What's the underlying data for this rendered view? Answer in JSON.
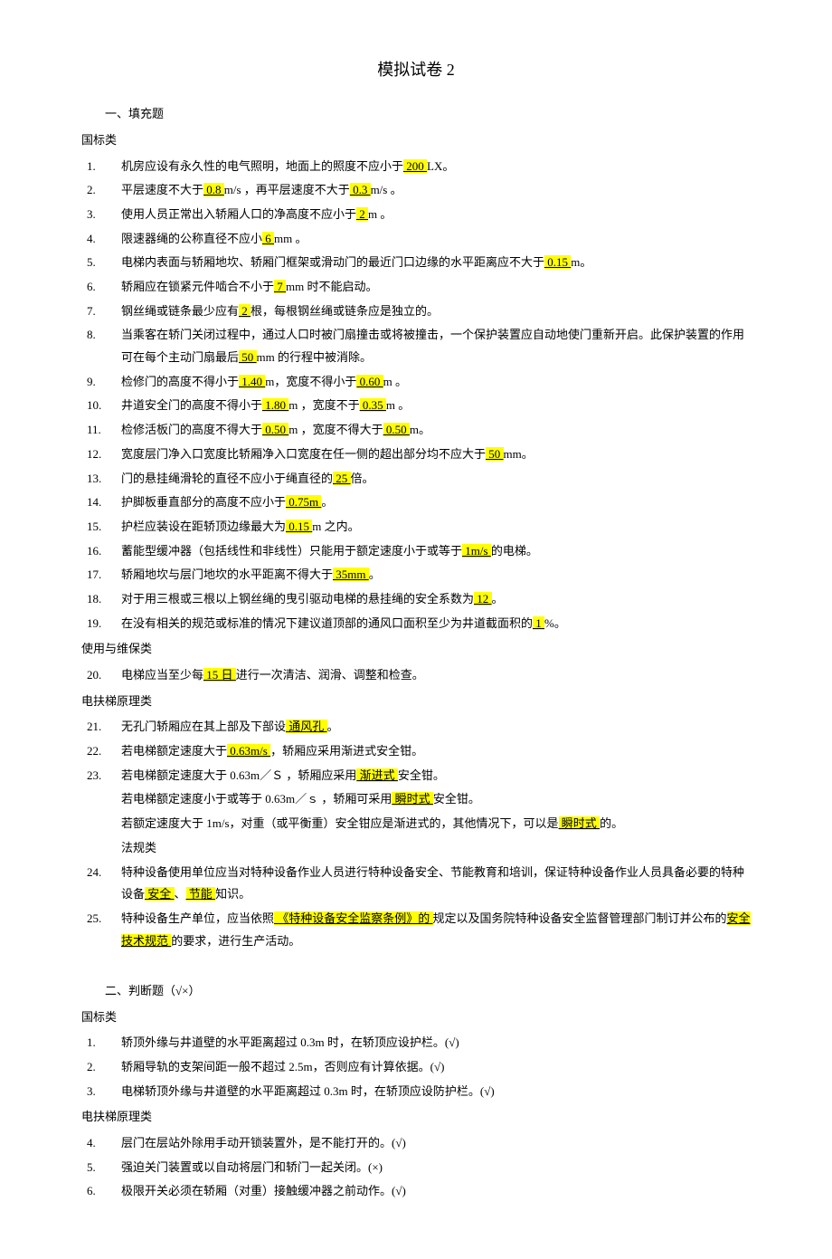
{
  "title": "模拟试卷 2",
  "section1_label": "一、填充题",
  "cat_guobiao": "国标类",
  "cat_shiyong": "使用与维保类",
  "cat_dianfu": "电扶梯原理类",
  "cat_fagui": "法规类",
  "section2_label": "二、判断题（√×）",
  "fill": {
    "q1a": "机房应设有永久性的电气照明，地面上的照度不应小于",
    "q1b": "LX。",
    "a1": "  200  ",
    "q2a": "平层速度不大于",
    "q2b": "m/s ，再平层速度不大于",
    "q2c": " m/s 。",
    "a2a": "  0.8  ",
    "a2b": "  0.3  ",
    "q3a": "使用人员正常出入轿厢人口的净高度不应小于",
    "q3b": "m 。",
    "a3": "  2  ",
    "q4a": "限速器绳的公称直径不应小",
    "q4b": "mm 。",
    "a4": "  6  ",
    "q5a": "电梯内表面与轿厢地坎、轿厢门框架或滑动门的最近门口边缘的水平距离应不大于",
    "q5b": " m。",
    "a5": " 0.15 ",
    "q6a": "轿厢应在锁紧元件啮合不小于",
    "q6b": " mm 时不能启动。",
    "a6": "   7  ",
    "q7a": "钢丝绳或链条最少应有",
    "q7b": " 根，每根钢丝绳或链条应是独立的。",
    "a7": "  2  ",
    "q8a": "当乘客在轿门关闭过程中，通过人口时被门扇撞击或将被撞击，一个保护装置应自动地使门重新开启。此保护装置的作用可在每个主动门扇最后",
    "q8b": "  mm 的行程中被消除。",
    "a8": "   50  ",
    "q9a": "检修门的高度不得小于",
    "q9b": " m，宽度不得小于",
    "q9c": " m 。",
    "a9a": "  1.40  ",
    "a9b": "  0.60  ",
    "q10a": "井道安全门的高度不得小于",
    "q10b": " m ，宽度不于",
    "q10c": " m 。",
    "a10a": "  1.80  ",
    "a10b": "  0.35  ",
    "q11a": "检修活板门的高度不得大于",
    "q11b": " m ，宽度不得大于",
    "q11c": "m。",
    "a11a": "  0.50  ",
    "a11b": "  0.50  ",
    "q12a": "宽度层门净入口宽度比轿厢净入口宽度在任一侧的超出部分均不应大于",
    "q12b": "  mm。",
    "a12": "  50  ",
    "q13a": "门的悬挂绳滑轮的直径不应小于绳直径的",
    "q13b": " 倍。",
    "a13": "  25  ",
    "q14a": "护脚板垂直部分的高度不应小于",
    "q14b": "。",
    "a14": "  0.75m  ",
    "q15a": "护栏应装设在距轿顶边缘最大为",
    "q15b": " m 之内。",
    "a15": "  0.15  ",
    "q16a": "蓄能型缓冲器（包括线性和非线性）只能用于额定速度小于或等于",
    "q16b": "的电梯。",
    "a16": "  1m/s  ",
    "q17a": "轿厢地坎与层门地坎的水平距离不得大于",
    "q17b": " 。",
    "a17": "  35mm  ",
    "q18a": "对于用三根或三根以上钢丝绳的曳引驱动电梯的悬挂绳的安全系数为",
    "q18b": " 。",
    "a18": "  12  ",
    "q19a": "在没有相关的规范或标准的情况下建议道顶部的通风口面积至少为井道截面积的",
    "q19b": " %。",
    "a19": " 1 ",
    "q20a": "电梯应当至少每",
    "q20b": " 进行一次清洁、润滑、调整和检查。",
    "a20": "  15 日  ",
    "q21a": "无孔门轿厢应在其上部及下部设",
    "q21b": "。",
    "a21": "  通风孔  ",
    "q22a": "若电梯额定速度大于",
    "q22b": " ，轿厢应采用渐进式安全钳。",
    "a22": "  0.63m/s  ",
    "q23a": "若电梯额定速度大于 0.63m／Ｓ ，轿厢应采用",
    "q23b": "  安全钳。",
    "a23a": "   渐进式   ",
    "q23c": " 若电梯额定速度小于或等于 0.63m／ｓ ，轿厢可采用",
    "q23d": "  安全钳。",
    "a23b": "   瞬时式   ",
    "q23e": " 若额定速度大于 1m/s，对重（或平衡重）安全钳应是渐进式的，其他情况下，可以是",
    "q23f": "的。",
    "a23c": "  瞬时式  ",
    "q23g": " 法规类",
    "q24a": "特种设备使用单位应当对特种设备作业人员进行特种设备安全、节能教育和培训，保证特种设备作业人员具备必要的特种设备",
    "q24b": "、",
    "q24c": " 知识。",
    "a24a": "   安全   ",
    "a24b": "  节能  ",
    "q25a": "特种设备生产单位，应当依照",
    "q25b": "规定以及国务院特种设备安全监督管理部门制订并公布的",
    "q25c": "的要求，进行生产活动。",
    "a25a": "  《特种设备安全监察条例》的  ",
    "a25b": "安全技术规范  "
  },
  "tf": {
    "q1": "轿顶外缘与井道壁的水平距离超过 0.3m 时，在轿顶应设护栏。(√)",
    "q2": "轿厢导轨的支架间距一般不超过 2.5m，否则应有计算依据。(√)",
    "q3": " 电梯轿顶外缘与井道壁的水平距离超过 0.3m 时，在轿顶应设防护栏。(√)",
    "q4": "层门在层站外除用手动开锁装置外，是不能打开的。(√)",
    "q5": "强迫关门装置或以自动将层门和轿门一起关闭。(×)",
    "q6": "极限开关必须在轿厢（对重）接触缓冲器之前动作。(√)"
  }
}
